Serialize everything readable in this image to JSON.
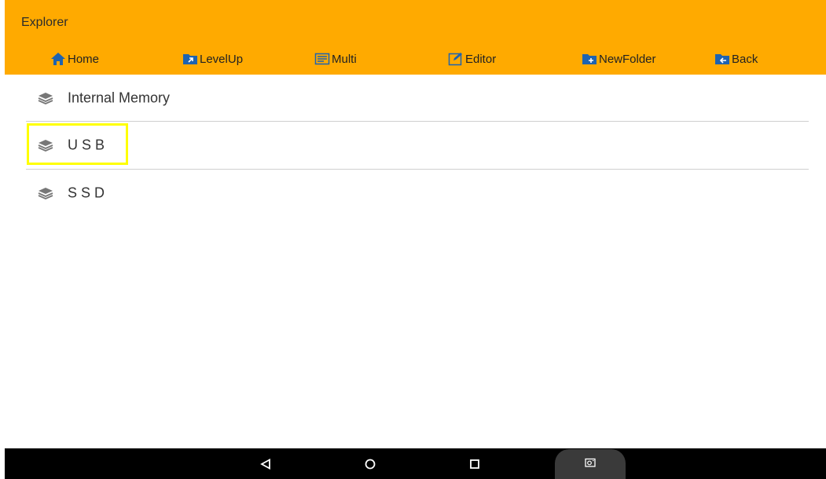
{
  "app": {
    "title": "Explorer",
    "accent": "#FFAA00"
  },
  "toolbar": {
    "items": [
      {
        "label": "Home",
        "icon": "home-icon"
      },
      {
        "label": "LevelUp",
        "icon": "folder-levelup-icon"
      },
      {
        "label": "Multi",
        "icon": "multi-select-icon"
      },
      {
        "label": "Editor",
        "icon": "edit-icon"
      },
      {
        "label": "NewFolder",
        "icon": "new-folder-icon"
      },
      {
        "label": "Back",
        "icon": "folder-back-icon"
      }
    ]
  },
  "storage": {
    "items": [
      {
        "label": "Internal Memory",
        "icon": "layers-icon"
      },
      {
        "label": "U S B",
        "icon": "layers-icon"
      },
      {
        "label": "S S D",
        "icon": "layers-icon"
      }
    ],
    "highlight_color": "#FFFF00"
  },
  "navbar": {
    "buttons": [
      "back-triangle-icon",
      "home-circle-icon",
      "recents-square-icon",
      "screenshot-icon"
    ]
  }
}
